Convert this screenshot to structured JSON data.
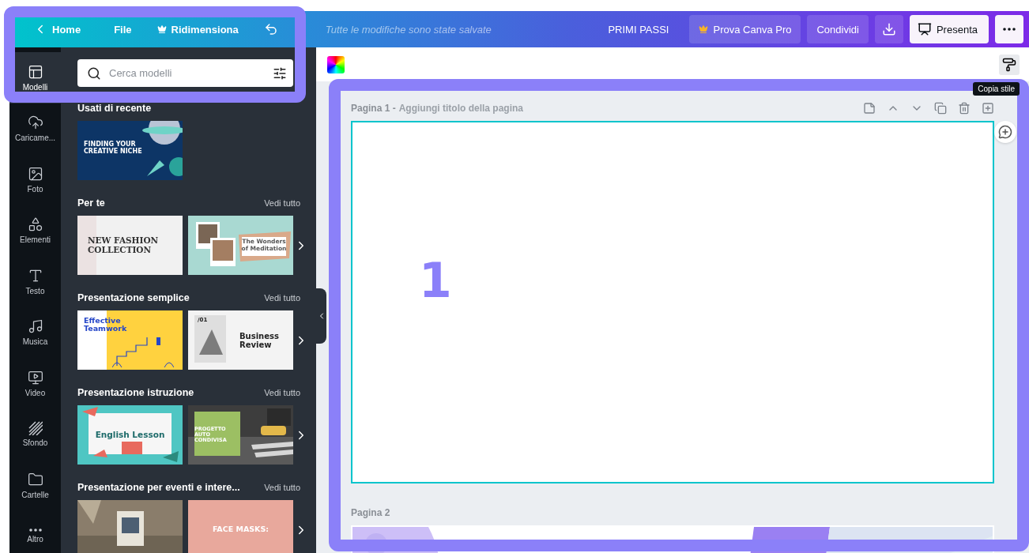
{
  "topbar": {
    "home": "Home",
    "file": "File",
    "resize": "Ridimensiona",
    "save_status": "Tutte le modifiche sono state salvate",
    "getting_started": "PRIMI PASSI",
    "try_pro": "Prova Canva Pro",
    "share": "Condividi",
    "present": "Presenta"
  },
  "rail": [
    {
      "label": "Modelli",
      "selected": true
    },
    {
      "label": "Caricame...",
      "selected": false
    },
    {
      "label": "Foto",
      "selected": false
    },
    {
      "label": "Elementi",
      "selected": false
    },
    {
      "label": "Testo",
      "selected": false
    },
    {
      "label": "Musica",
      "selected": false
    },
    {
      "label": "Video",
      "selected": false
    },
    {
      "label": "Sfondo",
      "selected": false
    },
    {
      "label": "Cartelle",
      "selected": false
    },
    {
      "label": "Altro",
      "selected": false
    }
  ],
  "panel": {
    "search": {
      "placeholder": "Cerca modelli"
    },
    "sections": [
      {
        "title": "Usati di recente",
        "templates": [
          {
            "kind": "navy",
            "title": "FINDING YOUR CREATIVE NICHE"
          }
        ]
      },
      {
        "title": "Per te",
        "see_all": "Vedi tutto",
        "templates": [
          {
            "kind": "fashion",
            "title": "NEW FASHION COLLECTION"
          },
          {
            "kind": "mint",
            "title": "The Wonders of Meditation"
          }
        ]
      },
      {
        "title": "Presentazione semplice",
        "see_all": "Vedi tutto",
        "templates": [
          {
            "kind": "yellow",
            "title": "Effective Teamwork"
          },
          {
            "kind": "gray",
            "tag": "/01",
            "title": "Business Review"
          }
        ]
      },
      {
        "title": "Presentazione istruzione",
        "see_all": "Vedi tutto",
        "templates": [
          {
            "kind": "teal",
            "title": "English Lesson"
          },
          {
            "kind": "street",
            "title": "PROGETTO AUTO CONDIVISA"
          }
        ]
      },
      {
        "title": "Presentazione per eventi e intere...",
        "see_all": "Vedi tutto",
        "templates": [
          {
            "kind": "room"
          },
          {
            "kind": "pink",
            "title": "FACE MASKS:"
          }
        ]
      }
    ]
  },
  "canvas": {
    "tooltip": "Copia stile",
    "pages": [
      {
        "kind": "blank",
        "label": "Pagina 1 -",
        "placeholder": "Aggiungi titolo della pagina",
        "selected": true
      },
      {
        "kind": "design",
        "label": "Pagina 2",
        "selected": false
      }
    ]
  },
  "annotations": [
    {
      "label": "1"
    }
  ]
}
